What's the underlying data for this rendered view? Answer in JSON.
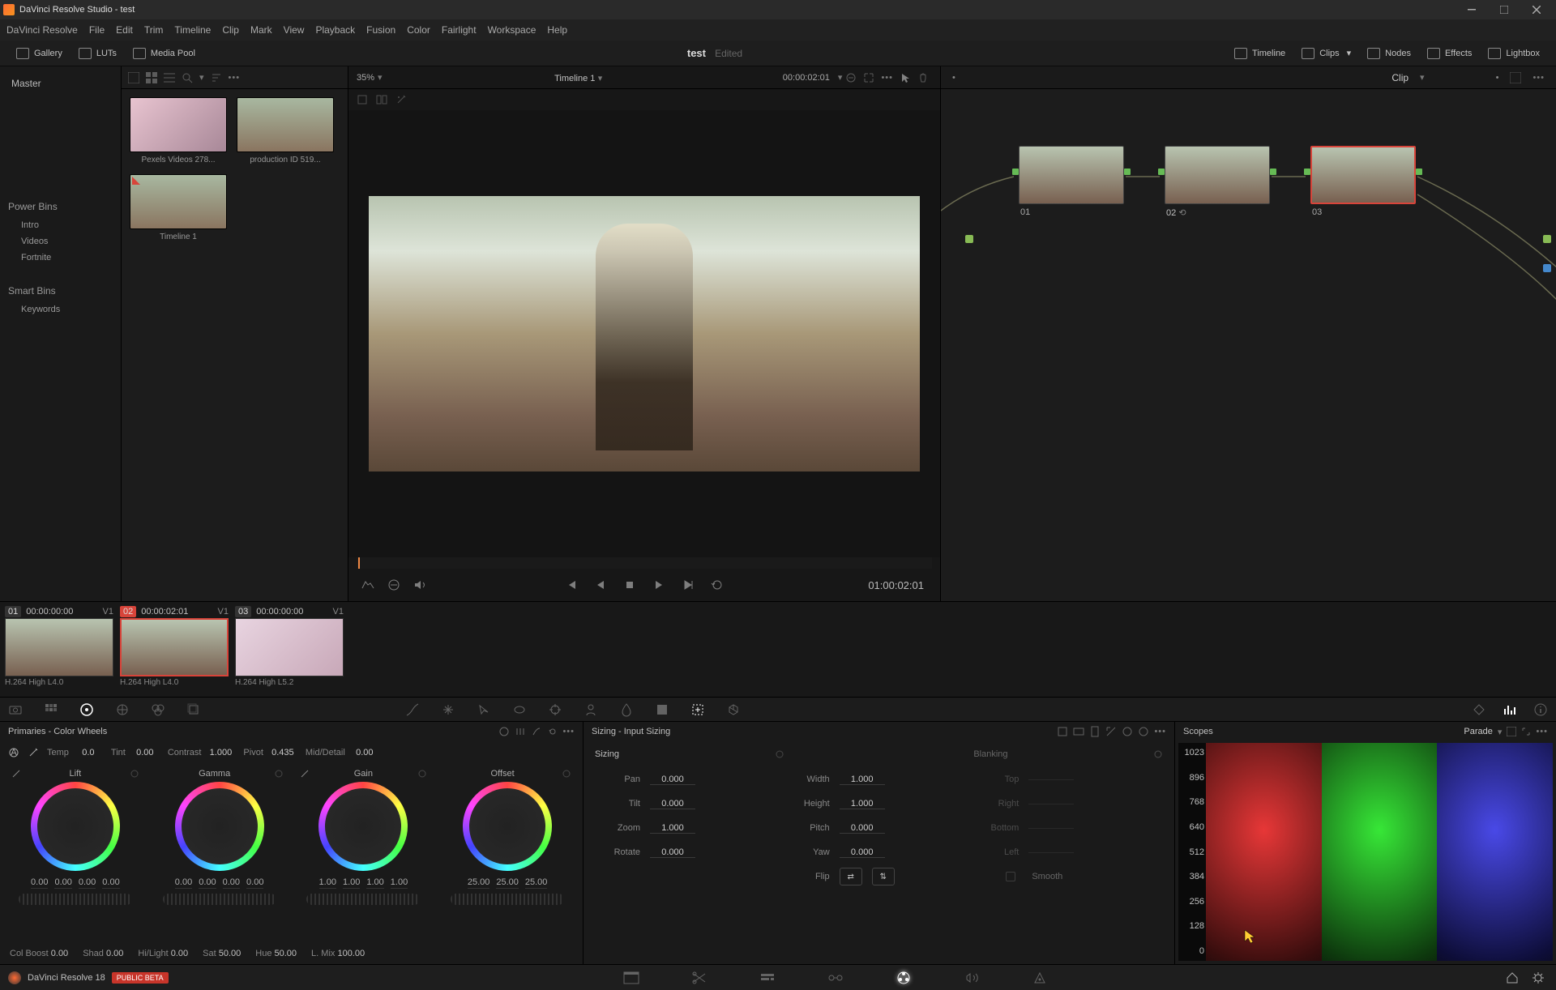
{
  "app": {
    "title": "DaVinci Resolve Studio - test",
    "version_label": "DaVinci Resolve 18",
    "beta_label": "PUBLIC BETA"
  },
  "menus": [
    "DaVinci Resolve",
    "File",
    "Edit",
    "Trim",
    "Timeline",
    "Clip",
    "Mark",
    "View",
    "Playback",
    "Fusion",
    "Color",
    "Fairlight",
    "Workspace",
    "Help"
  ],
  "toolbar": {
    "gallery": "Gallery",
    "luts": "LUTs",
    "mediapool": "Media Pool",
    "project": "test",
    "edited": "Edited",
    "timeline_btn": "Timeline",
    "clips_btn": "Clips",
    "nodes_btn": "Nodes",
    "effects_btn": "Effects",
    "lightbox_btn": "Lightbox"
  },
  "sidebar": {
    "master": "Master",
    "powerbins": "Power Bins",
    "pb_items": [
      "Intro",
      "Videos",
      "Fortnite"
    ],
    "smartbins": "Smart Bins",
    "sb_items": [
      "Keywords"
    ]
  },
  "media": {
    "clips": [
      {
        "name": "Pexels Videos 278..."
      },
      {
        "name": "production ID 519..."
      },
      {
        "name": "Timeline 1"
      }
    ]
  },
  "viewer": {
    "zoom": "35%",
    "timeline_name": "Timeline 1",
    "tc_top": "00:00:02:01",
    "tc_transport": "01:00:02:01"
  },
  "node_header": {
    "clip_label": "Clip"
  },
  "nodes": [
    {
      "label": "01"
    },
    {
      "label": "02"
    },
    {
      "label": "03"
    }
  ],
  "clipstrip": [
    {
      "num": "01",
      "tc": "00:00:00:00",
      "v": "V1",
      "codec": "H.264 High L4.0"
    },
    {
      "num": "02",
      "tc": "00:00:02:01",
      "v": "V1",
      "codec": "H.264 High L4.0"
    },
    {
      "num": "03",
      "tc": "00:00:00:00",
      "v": "V1",
      "codec": "H.264 High L5.2"
    }
  ],
  "wheels": {
    "title": "Primaries - Color Wheels",
    "params": {
      "temp_lbl": "Temp",
      "temp": "0.0",
      "tint_lbl": "Tint",
      "tint": "0.00",
      "contrast_lbl": "Contrast",
      "contrast": "1.000",
      "pivot_lbl": "Pivot",
      "pivot": "0.435",
      "md_lbl": "Mid/Detail",
      "md": "0.00"
    },
    "lift": {
      "name": "Lift",
      "nums": [
        "0.00",
        "0.00",
        "0.00",
        "0.00"
      ]
    },
    "gamma": {
      "name": "Gamma",
      "nums": [
        "0.00",
        "0.00",
        "0.00",
        "0.00"
      ]
    },
    "gain": {
      "name": "Gain",
      "nums": [
        "1.00",
        "1.00",
        "1.00",
        "1.00"
      ]
    },
    "offset": {
      "name": "Offset",
      "nums": [
        "25.00",
        "25.00",
        "25.00"
      ]
    },
    "row2": {
      "colboost_lbl": "Col Boost",
      "colboost": "0.00",
      "shad_lbl": "Shad",
      "shad": "0.00",
      "hilight_lbl": "Hi/Light",
      "hilight": "0.00",
      "sat_lbl": "Sat",
      "sat": "50.00",
      "hue_lbl": "Hue",
      "hue": "50.00",
      "lmix_lbl": "L. Mix",
      "lmix": "100.00"
    }
  },
  "sizing": {
    "title": "Sizing - Input Sizing",
    "left_title": "Sizing",
    "right_title": "Blanking",
    "pan_lbl": "Pan",
    "pan": "0.000",
    "tilt_lbl": "Tilt",
    "tilt": "0.000",
    "zoom_lbl": "Zoom",
    "zoom": "1.000",
    "rotate_lbl": "Rotate",
    "rotate": "0.000",
    "width_lbl": "Width",
    "width": "1.000",
    "height_lbl": "Height",
    "height": "1.000",
    "pitch_lbl": "Pitch",
    "pitch": "0.000",
    "yaw_lbl": "Yaw",
    "yaw": "0.000",
    "flip_lbl": "Flip",
    "top_lbl": "Top",
    "right_lbl": "Right",
    "bottom_lbl": "Bottom",
    "left_lbl": "Left",
    "smooth_lbl": "Smooth"
  },
  "scopes": {
    "title": "Scopes",
    "mode": "Parade",
    "ticks": [
      "1023",
      "896",
      "768",
      "640",
      "512",
      "384",
      "256",
      "128",
      "0"
    ]
  }
}
